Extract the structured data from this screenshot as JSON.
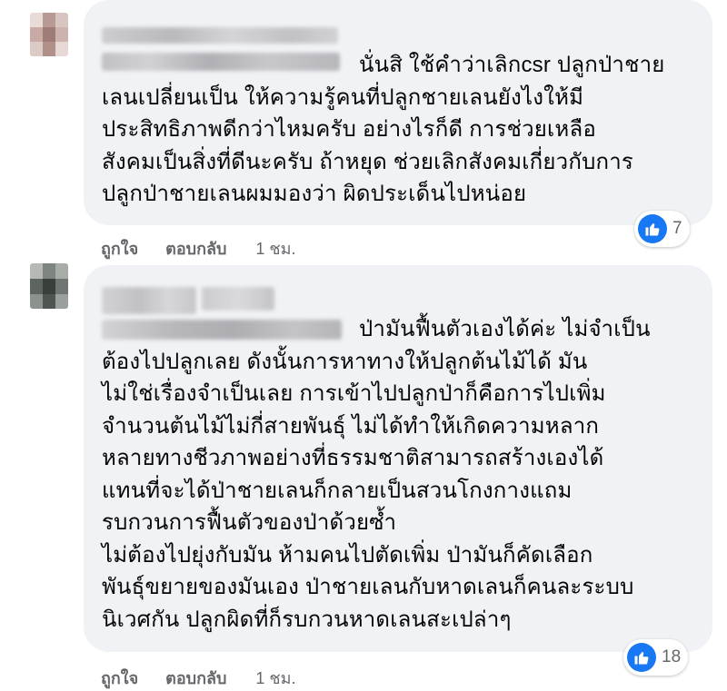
{
  "comments": [
    {
      "text": "นั่นสิ ใช้คำว่าเลิกcsr ปลูกป่าชาย\nเลนเปลี่ยนเป็น ให้ความรู้คนที่ปลูกชายเลนยังไงให้มี\nประสิทธิภาพดีกว่าไหมครับ อย่างไรก็ดี การช่วยเหลือ\nสังคมเป็นสิ่งที่ดีนะครับ ถ้าหยุด ช่วยเลิกสังคมเกี่ยวกับการ\nปลูกป่าชายเลนผมมองว่า ผิดประเด็นไปหน่อย",
      "reaction_count": "7",
      "like_label": "ถูกใจ",
      "reply_label": "ตอบกลับ",
      "time": "1 ชม."
    },
    {
      "text": "ป่ามันฟื้นตัวเองได้ค่ะ ไม่จำเป็น\nต้องไปปลูกเลย ดังนั้นการหาทางให้ปลูกต้นไม้ได้ มัน\nไม่ใช่เรื่องจำเป็นเลย การเข้าไปปลูกป่าก็คือการไปเพิ่ม\nจำนวนต้นไม้ไม่กี่สายพันธุ์ ไม่ได้ทำให้เกิดความหลาก\nหลายทางชีวภาพอย่างที่ธรรมชาติสามารถสร้างเองได้\nแทนที่จะได้ป่าชายเลนก็กลายเป็นสวนโกงกางแถม\nรบกวนการฟื้นตัวของป่าด้วยซ้ำ\nไม่ต้องไปยุ่งกับมัน ห้ามคนไปตัดเพิ่ม ป่ามันก็คัดเลือก\nพันธุ์ขยายของมันเอง ป่าชายเลนกับหาดเลนก็คนละระบบ\nนิเวศกัน ปลูกผิดที่ก็รบกวนหาดเลนสะเปล่าๆ",
      "reaction_count": "18",
      "like_label": "ถูกใจ",
      "reply_label": "ตอบกลับ",
      "time": "1 ชม."
    }
  ],
  "colors": {
    "bubble": "#f0f2f5",
    "text": "#050505",
    "secondary": "#65676b",
    "like_blue": "#1877f2"
  },
  "icons": {
    "reaction": "thumbs-up-icon"
  }
}
